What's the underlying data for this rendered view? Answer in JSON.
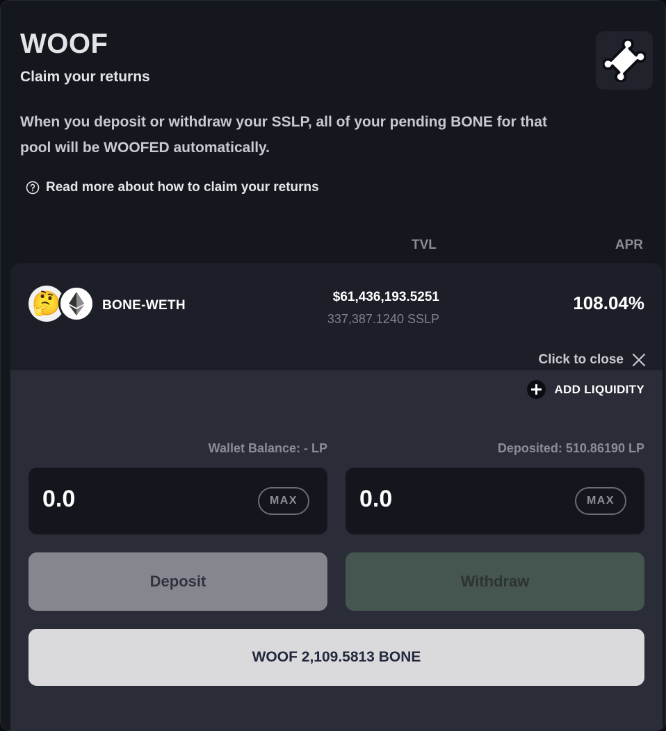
{
  "header": {
    "title": "WOOF",
    "subtitle": "Claim your returns",
    "description": "When you deposit or withdraw your SSLP, all of your pending BONE for that pool will be WOOFED automatically.",
    "read_more": "Read more about how to claim your returns"
  },
  "columns": {
    "tvl": "TVL",
    "apr": "APR"
  },
  "pool": {
    "pair": "BONE-WETH",
    "tvl_usd": "$61,436,193.5251",
    "tvl_sslp": "337,387.1240 SSLP",
    "apr": "108.04%",
    "close_label": "Click to close",
    "add_liquidity": "ADD LIQUIDITY",
    "wallet_balance": "Wallet Balance: - LP",
    "deposited": "Deposited: 510.86190 LP",
    "deposit_value": "0.0",
    "withdraw_value": "0.0",
    "max_label": "MAX",
    "deposit_button": "Deposit",
    "withdraw_button": "Withdraw",
    "woof_button": "WOOF 2,109.5813 BONE"
  },
  "icons": {
    "bone": "bone-icon",
    "help": "help-circle-icon",
    "token0": "thinking-face-emoji",
    "token1": "ethereum-icon",
    "close": "close-icon",
    "plus": "plus-icon"
  },
  "colors": {
    "background": "#15171f",
    "panel": "#2a2d37",
    "deposit_button": "#85878e",
    "withdraw_button": "#45554f",
    "woof_button": "#dadadd"
  }
}
